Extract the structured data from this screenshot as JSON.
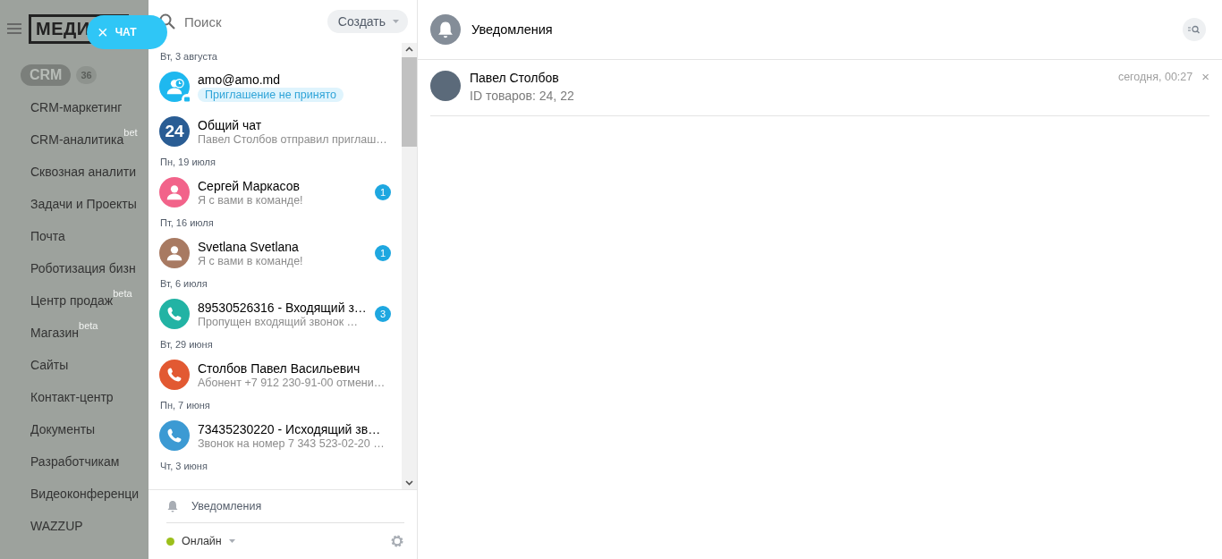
{
  "sidebar": {
    "logo": "МЕДИ",
    "chat_button": {
      "icon": "×",
      "label": "ЧАТ"
    },
    "crm": {
      "label": "CRM",
      "count": "36"
    },
    "items": [
      {
        "label": "CRM-маркетинг"
      },
      {
        "label": "CRM-аналитика",
        "badge": "bet"
      },
      {
        "label": "Сквозная аналити"
      },
      {
        "label": "Задачи и Проекты"
      },
      {
        "label": "Почта"
      },
      {
        "label": "Роботизация бизн"
      },
      {
        "label": "Центр продаж",
        "badge": "beta"
      },
      {
        "label": "Магазин",
        "badge": "beta"
      },
      {
        "label": "Сайты"
      },
      {
        "label": "Контакт-центр"
      },
      {
        "label": "Документы"
      },
      {
        "label": "Разработчикам"
      },
      {
        "label": "Видеоконференци"
      },
      {
        "label": "WAZZUP"
      }
    ]
  },
  "chat_list": {
    "search": {
      "placeholder": "Поиск"
    },
    "create_button": "Создать",
    "groups": [
      {
        "date": "Вт, 3 августа",
        "chats": [
          {
            "kind": "invite",
            "color": "#1eb8ef",
            "name": "amo@amo.md",
            "status": "Приглашение не принято"
          },
          {
            "kind": "group",
            "color": "#2a5d94",
            "avatar_text": "24",
            "name": "Общий чат",
            "preview": "Павел Столбов отправил приглаш…"
          }
        ]
      },
      {
        "date": "Пн, 19 июля",
        "chats": [
          {
            "kind": "user",
            "color": "#f2638a",
            "name": "Сергей Маркасов",
            "preview": "Я с вами в команде!",
            "unread": "1"
          }
        ]
      },
      {
        "date": "Пт, 16 июля",
        "chats": [
          {
            "kind": "user",
            "color": "#a87a62",
            "name": "Svetlana Svetlana",
            "preview": "Я с вами в команде!",
            "unread": "1"
          }
        ]
      },
      {
        "date": "Вт, 6 июля",
        "chats": [
          {
            "kind": "phone",
            "color": "#22b3a4",
            "name": "89530526316 - Входящий з…",
            "preview": "Пропущен входящий звонок …",
            "unread": "3"
          }
        ]
      },
      {
        "date": "Вт, 29 июня",
        "chats": [
          {
            "kind": "phone",
            "color": "#e25932",
            "name": "Столбов Павел Васильевич",
            "preview": "Абонент +7 912 230-91-00 отмени…"
          }
        ]
      },
      {
        "date": "Пн, 7 июня",
        "chats": [
          {
            "kind": "phone",
            "color": "#3c9ad3",
            "name": "73435230220 - Исходящий зв…",
            "preview": "Звонок на номер 7 343 523-02-20 …"
          }
        ]
      },
      {
        "date": "Чт, 3 июня"
      }
    ],
    "notifications_link": "Уведомления",
    "status": {
      "label": "Онлайн",
      "color": "#9cbf1b"
    }
  },
  "panel": {
    "title": "Уведомления",
    "notifications": [
      {
        "name": "Павел Столбов",
        "text": "ID товаров: 24, 22",
        "time": "сегодня, 00:27",
        "close": "×"
      }
    ]
  }
}
